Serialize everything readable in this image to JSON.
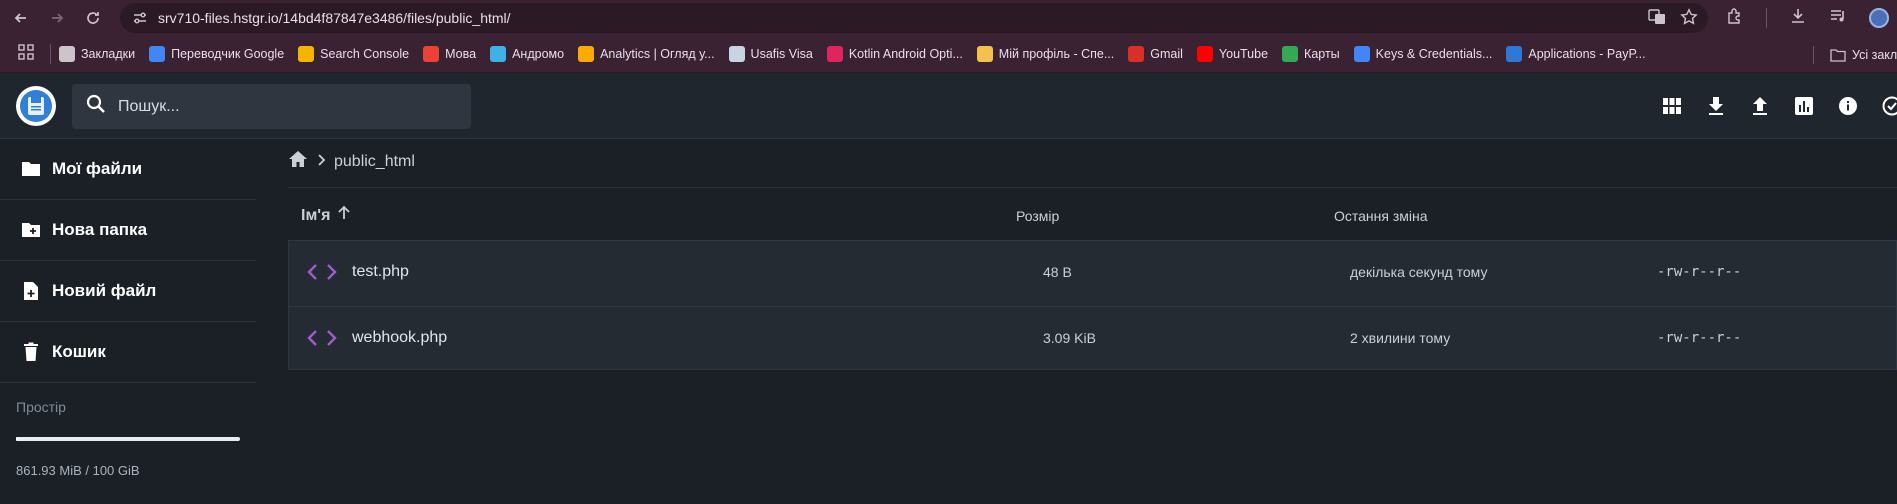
{
  "browser": {
    "url": "srv710-files.hstgr.io/14bd4f87847e3486/files/public_html/",
    "bookmarks": [
      {
        "label": "Закладки",
        "icon": "folder-icon",
        "color": "#cfc3cb"
      },
      {
        "label": "Переводчик Google",
        "icon": "google-translate-icon",
        "color": "#4285f4"
      },
      {
        "label": "Search Console",
        "icon": "search-console-icon",
        "color": "#f4b400"
      },
      {
        "label": "Мова",
        "icon": "google-icon",
        "color": "#ea4335"
      },
      {
        "label": "Андромо",
        "icon": "andromo-icon",
        "color": "#3fb0e8"
      },
      {
        "label": "Analytics | Огляд у...",
        "icon": "analytics-icon",
        "color": "#f9ab00"
      },
      {
        "label": "Usafis Visa",
        "icon": "page-icon",
        "color": "#c8d3e6"
      },
      {
        "label": "Kotlin Android Opti...",
        "icon": "kotlin-icon",
        "color": "#e0245e"
      },
      {
        "label": "Мій профіль - Спе...",
        "icon": "medal-icon",
        "color": "#f2c14e"
      },
      {
        "label": "Gmail",
        "icon": "gmail-icon",
        "color": "#d93025"
      },
      {
        "label": "YouTube",
        "icon": "youtube-icon",
        "color": "#ff0000"
      },
      {
        "label": "Карты",
        "icon": "maps-icon",
        "color": "#34a853"
      },
      {
        "label": "Keys & Credentials...",
        "icon": "pin-icon",
        "color": "#4285f4"
      },
      {
        "label": "Applications - PayP...",
        "icon": "paypal-icon",
        "color": "#2f78d6"
      }
    ],
    "all_bookmarks": "Усі закладки"
  },
  "header": {
    "search_placeholder": "Пошук...",
    "actions": [
      "grid-view-icon",
      "download-icon",
      "upload-icon",
      "chart-icon",
      "info-icon",
      "check-circle-icon"
    ]
  },
  "sidebar": {
    "items": [
      {
        "label": "Мої файли",
        "icon": "folder-icon"
      },
      {
        "label": "Нова папка",
        "icon": "new-folder-icon"
      },
      {
        "label": "Новий файл",
        "icon": "new-file-icon"
      },
      {
        "label": "Кошик",
        "icon": "trash-icon"
      }
    ],
    "storage": {
      "title": "Простір",
      "usage": "861.93 MiB / 100 GiB",
      "used_fraction": 0.0084
    }
  },
  "breadcrumb": {
    "current": "public_html"
  },
  "table": {
    "columns": {
      "name": "Ім'я",
      "size": "Розмір",
      "modified": "Остання зміна"
    },
    "rows": [
      {
        "name": "test.php",
        "size": "48 B",
        "modified": "декілька секунд тому",
        "permissions": "-rw-r--r--"
      },
      {
        "name": "webhook.php",
        "size": "3.09 KiB",
        "modified": "2 хвилини тому",
        "permissions": "-rw-r--r--"
      }
    ]
  },
  "colors": {
    "accent": "#2f80d6",
    "code_icon": "#a05cc8",
    "background": "#1b2027"
  }
}
